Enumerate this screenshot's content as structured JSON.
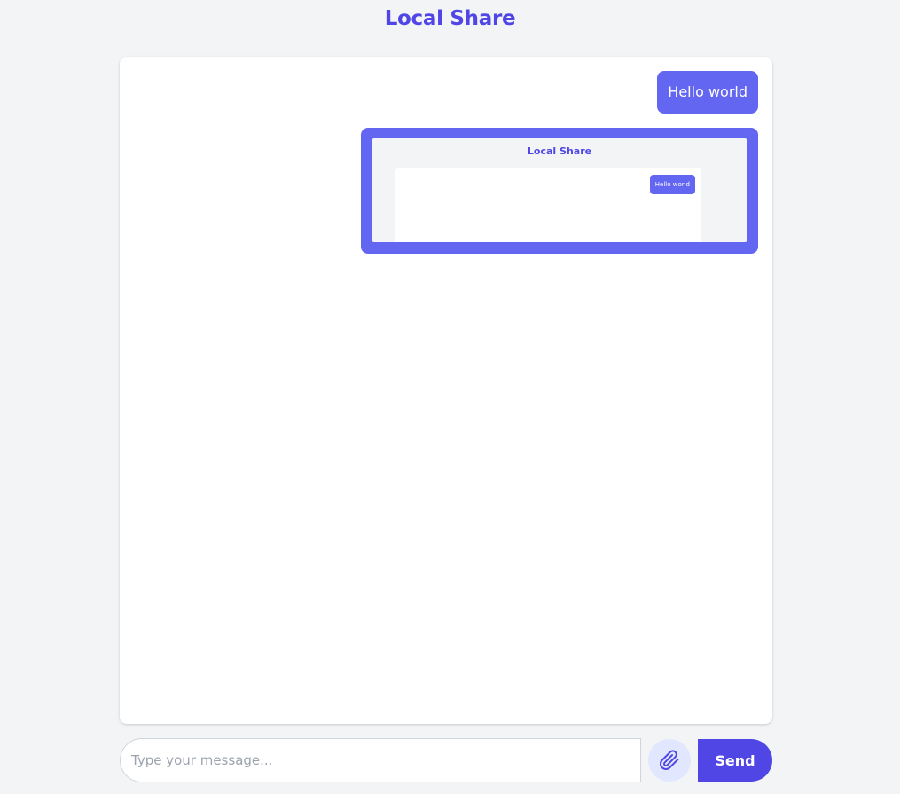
{
  "header": {
    "title": "Local Share"
  },
  "messages": [
    {
      "type": "text",
      "text": "Hello world"
    },
    {
      "type": "image",
      "preview": {
        "title": "Local Share",
        "bubble_text": "Hello world"
      }
    }
  ],
  "composer": {
    "placeholder": "Type your message...",
    "value": "",
    "attach_icon": "paperclip-icon",
    "send_label": "Send"
  },
  "colors": {
    "accent": "#4f46e5",
    "bubble": "#6366f1",
    "attach_bg": "#e0e7ff",
    "page_bg": "#f3f4f6"
  }
}
